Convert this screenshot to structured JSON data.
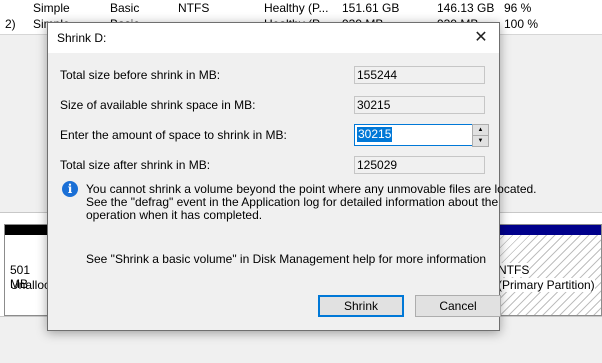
{
  "background": {
    "rows": [
      {
        "layout": "Simple",
        "type": "Basic",
        "fs": "NTFS",
        "status": "Healthy (P...",
        "capacity": "151.61 GB",
        "free": "146.13 GB",
        "pct": "96 %"
      },
      {
        "prefix": "2)",
        "layout": "Simple",
        "type": "Basic",
        "fs": "",
        "status": "Healthy (P...",
        "capacity": "939 MB",
        "free": "939 MB",
        "pct": "100 %"
      }
    ],
    "left_volume": {
      "line1": "501 MB",
      "line2": "Unallocated"
    },
    "right_volume": {
      "line1": "NTFS",
      "line2": "(Primary Partition)"
    }
  },
  "dialog": {
    "title": "Shrink D:",
    "close_glyph": "✕",
    "fields": {
      "total_before_label": "Total size before shrink in MB:",
      "total_before_value": "155244",
      "available_label": "Size of available shrink space in MB:",
      "available_value": "30215",
      "amount_label": "Enter the amount of space to shrink in MB:",
      "amount_value": "30215",
      "total_after_label": "Total size after shrink in MB:",
      "total_after_value": "125029"
    },
    "info_icon": "i",
    "info_lines": [
      "You cannot shrink a volume beyond the point where any unmovable files are located.",
      "See the \"defrag\" event in the Application log for detailed information about the",
      "operation when it has completed."
    ],
    "help_text": "See \"Shrink a basic volume\" in Disk Management help for more information",
    "buttons": {
      "shrink": "Shrink",
      "cancel": "Cancel"
    },
    "spin": {
      "up": "▲",
      "down": "▼"
    }
  }
}
